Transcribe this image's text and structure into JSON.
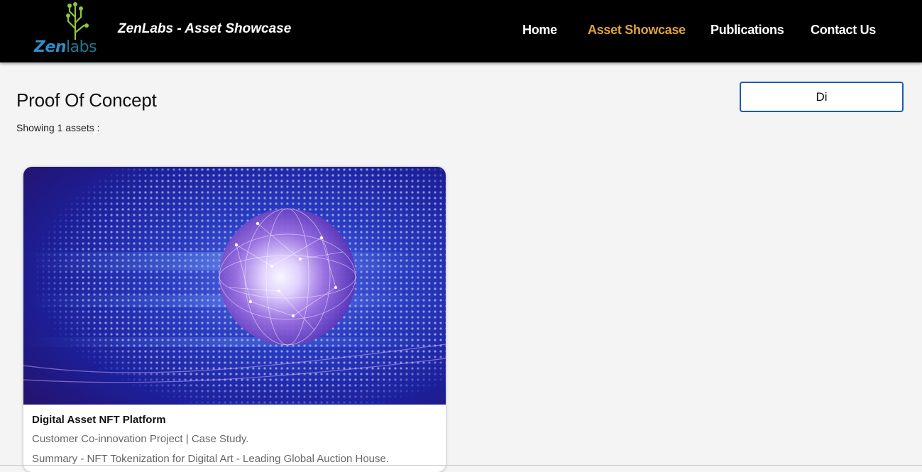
{
  "header": {
    "logo": {
      "text_part1": "Zen",
      "text_part2": "labs",
      "colors": {
        "circuit": "#8cc63f",
        "text_blue": "#2d8fc9",
        "text_teal": "#1f7a8c"
      }
    },
    "site_title": "ZenLabs - Asset Showcase",
    "nav": [
      {
        "label": "Home",
        "active": false
      },
      {
        "label": "Asset Showcase",
        "active": true
      },
      {
        "label": "Publications",
        "active": false
      },
      {
        "label": "Contact Us",
        "active": false
      }
    ],
    "colors": {
      "background": "#000000",
      "link": "#ffffff",
      "active_link": "#e0a43c"
    }
  },
  "page": {
    "title": "Proof Of Concept",
    "asset_count_text": "Showing 1 assets :",
    "filter": {
      "value": "Di",
      "border_color": "#1c5fa8"
    }
  },
  "cards": [
    {
      "image_icon": "glowing-network-sphere-image",
      "title": "Digital Asset NFT Platform",
      "subtitle": "Customer Co-innovation Project | Case Study.",
      "summary": "Summary - NFT Tokenization for Digital Art - Leading Global Auction House."
    }
  ]
}
